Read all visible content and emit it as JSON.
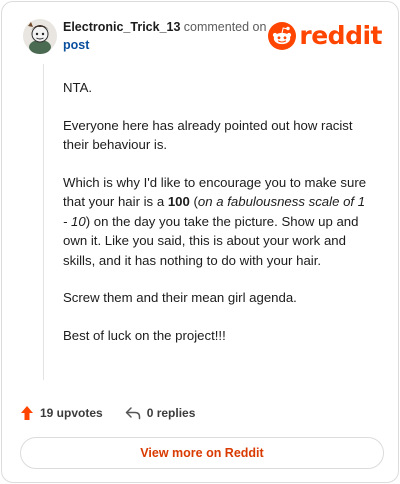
{
  "comment": {
    "username": "Electronic_Trick_13",
    "commented_text": "commented on",
    "post_link": "post",
    "paragraphs": {
      "p1": "NTA.",
      "p2": "Everyone here has already pointed out how racist their behaviour is.",
      "p3_a": "Which is why I'd like to encourage you to make sure that your hair is a ",
      "p3_bold": "100",
      "p3_b": " (",
      "p3_italic": "on a fabulousness scale of 1 - 10",
      "p3_c": ") on the day you take the picture. Show up and own it. Like you said, this is about your work and skills, and it has nothing to do with your hair.",
      "p4": "Screw them and their mean girl agenda.",
      "p5": "Best of luck on the project!!!"
    }
  },
  "brand": {
    "wordmark": "reddit",
    "color": "#ff4500"
  },
  "actions": {
    "upvotes": "19 upvotes",
    "replies": "0 replies"
  },
  "footer": {
    "view_more": "View more on Reddit"
  },
  "icons": {
    "avatar": "user-avatar",
    "logo": "reddit-logo-icon",
    "upvote": "upvote-arrow-icon",
    "reply": "reply-arrow-icon"
  }
}
